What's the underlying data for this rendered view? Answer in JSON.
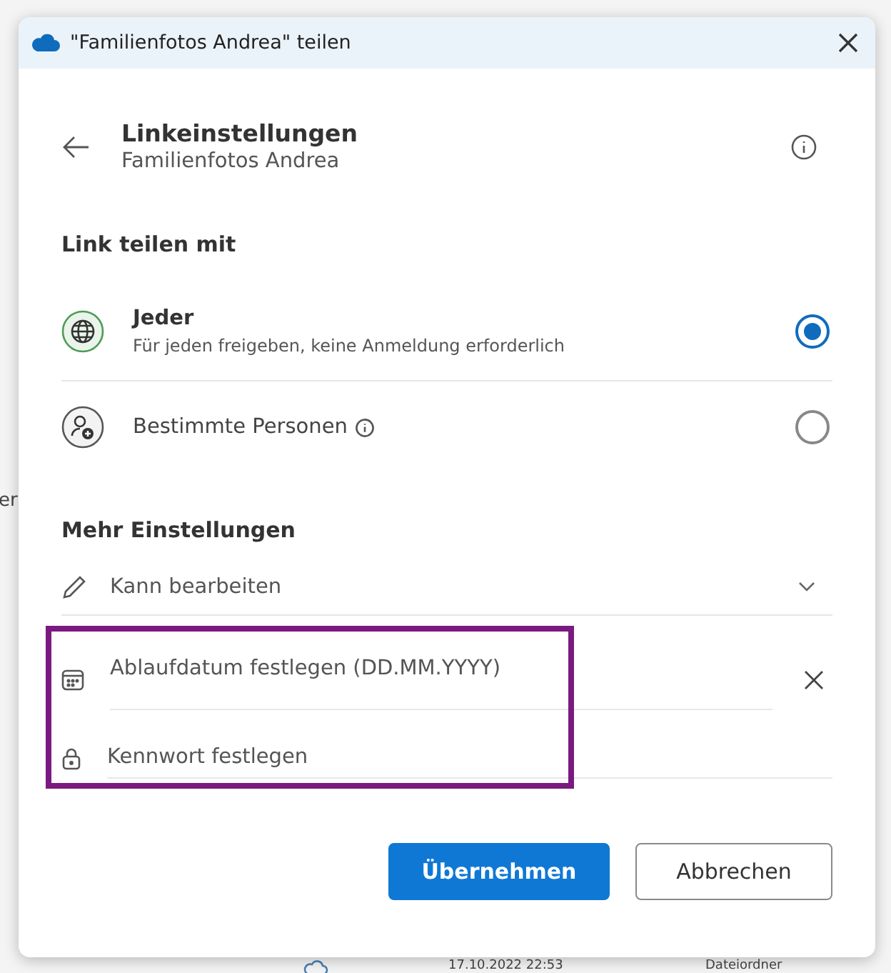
{
  "background": {
    "texts": [
      {
        "kind": "side",
        "text": "er"
      },
      {
        "kind": "date",
        "text": "17.10.2022 22:53"
      },
      {
        "kind": "type",
        "text": "Dateiordner"
      }
    ]
  },
  "window": {
    "title": "\"Familienfotos Andrea\" teilen"
  },
  "header": {
    "title": "Linkeinstellungen",
    "subtitle": "Familienfotos Andrea"
  },
  "share_section": {
    "heading": "Link teilen mit",
    "options": [
      {
        "kind": "everyone",
        "label": "Jeder",
        "description": "Für jeden freigeben, keine Anmeldung erforderlich",
        "info": false,
        "selected": true
      },
      {
        "kind": "people",
        "label": "Bestimmte Personen",
        "info": true,
        "selected": false
      }
    ]
  },
  "more_section": {
    "heading": "Mehr Einstellungen",
    "settings": [
      {
        "kind": "permission",
        "value": "Kann bearbeiten"
      },
      {
        "kind": "date",
        "placeholder": "Ablaufdatum festlegen (DD.MM.YYYY)",
        "clearable": true
      },
      {
        "kind": "password",
        "placeholder": "Kennwort festlegen"
      }
    ]
  },
  "buttons": [
    {
      "kind": "primary",
      "label": "Übernehmen"
    },
    {
      "kind": "secondary",
      "label": "Abbrechen"
    }
  ]
}
